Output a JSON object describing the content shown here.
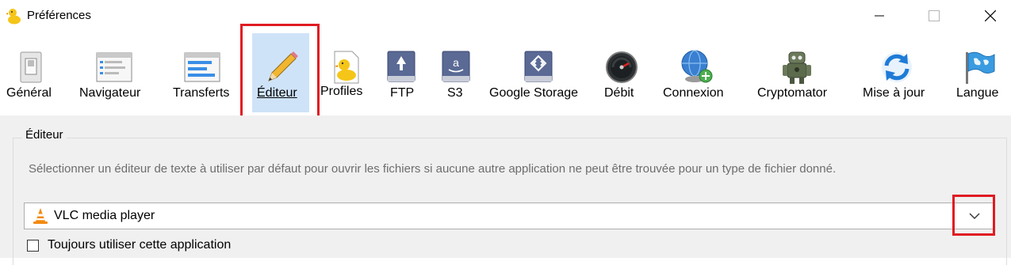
{
  "window": {
    "title": "Préférences"
  },
  "toolbar": {
    "items": [
      {
        "label": "Général",
        "icon": "toggle-switch-icon"
      },
      {
        "label": "Navigateur",
        "icon": "browser-window-icon"
      },
      {
        "label": "Transferts",
        "icon": "transfer-window-icon"
      },
      {
        "label": "Éditeur",
        "icon": "pencil-icon",
        "selected": true
      },
      {
        "label": "Profiles",
        "icon": "duck-document-icon"
      },
      {
        "label": "FTP",
        "icon": "ftp-drive-icon"
      },
      {
        "label": "S3",
        "icon": "amazon-drive-icon"
      },
      {
        "label": "Google Storage",
        "icon": "google-drive-icon"
      },
      {
        "label": "Débit",
        "icon": "speedometer-icon"
      },
      {
        "label": "Connexion",
        "icon": "globe-add-icon"
      },
      {
        "label": "Cryptomator",
        "icon": "robot-icon"
      },
      {
        "label": "Mise à jour",
        "icon": "refresh-icon"
      },
      {
        "label": "Langue",
        "icon": "flag-icon"
      }
    ]
  },
  "editor": {
    "group_title": "Éditeur",
    "description": "Sélectionner un éditeur de texte à utiliser par défaut pour ouvrir les fichiers si aucune autre application ne peut être trouvée pour un type de fichier donné.",
    "selected_app": "VLC media player",
    "always_use_label": "Toujours utiliser cette application",
    "always_use_checked": false
  },
  "colors": {
    "highlight": "#e01b22",
    "selected_bg": "#cfe3f8",
    "panel_bg": "#f0f0f0"
  }
}
